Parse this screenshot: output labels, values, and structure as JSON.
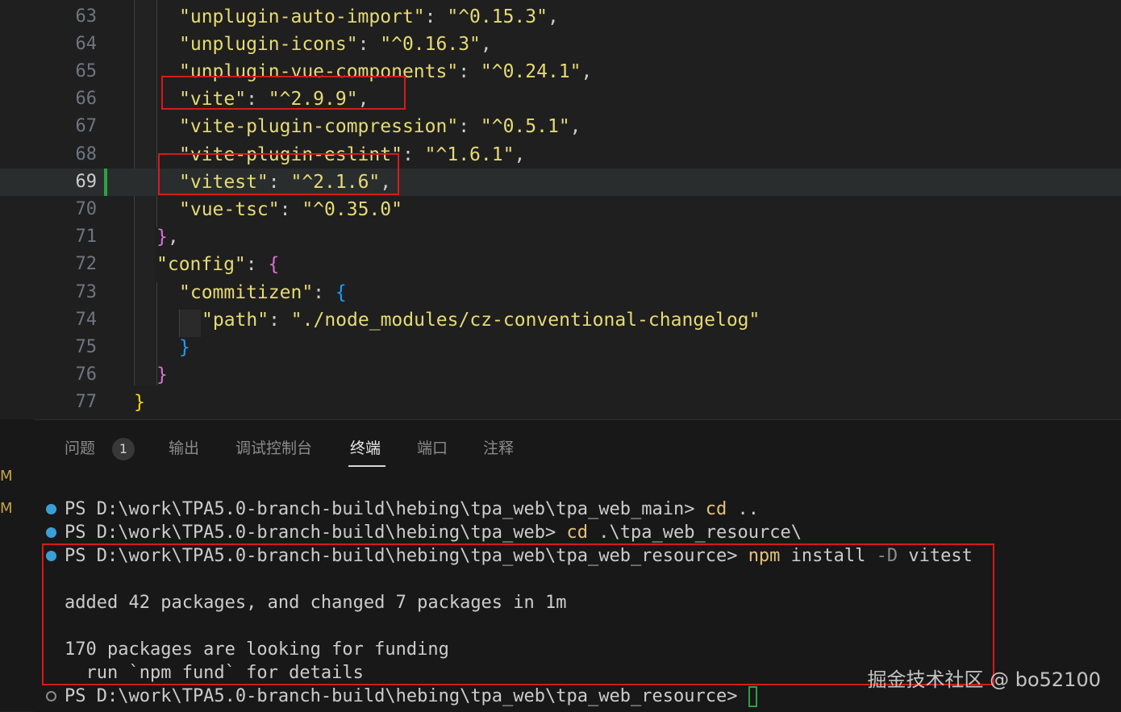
{
  "editor": {
    "lines": [
      {
        "n": "63",
        "key": "\"unplugin-auto-import\"",
        "val": "\"^0.15.3\"",
        "tail": ","
      },
      {
        "n": "64",
        "key": "\"unplugin-icons\"",
        "val": "\"^0.16.3\"",
        "tail": ","
      },
      {
        "n": "65",
        "key": "\"unplugin-vue-components\"",
        "val": "\"^0.24.1\"",
        "tail": ","
      },
      {
        "n": "66",
        "key": "\"vite\"",
        "val": "\"^2.9.9\"",
        "tail": ","
      },
      {
        "n": "67",
        "key": "\"vite-plugin-compression\"",
        "val": "\"^0.5.1\"",
        "tail": ","
      },
      {
        "n": "68",
        "key": "\"vite-plugin-eslint\"",
        "val": "\"^1.6.1\"",
        "tail": ","
      },
      {
        "n": "69",
        "key": "\"vitest\"",
        "val": "\"^2.1.6\"",
        "tail": ","
      },
      {
        "n": "70",
        "key": "\"vue-tsc\"",
        "val": "\"^0.35.0\"",
        "tail": ""
      },
      {
        "n": "71",
        "brace": "}",
        "tail": ","
      },
      {
        "n": "72",
        "key": "\"config\"",
        "brace": "{"
      },
      {
        "n": "73",
        "key": "\"commitizen\"",
        "brace": "{"
      },
      {
        "n": "74",
        "key": "\"path\"",
        "val": "\"./node_modules/cz-conventional-changelog\"",
        "tail": ""
      },
      {
        "n": "75",
        "brace": "}"
      },
      {
        "n": "76",
        "brace": "}"
      },
      {
        "n": "77",
        "brace": "}"
      }
    ]
  },
  "panel": {
    "tabs": [
      {
        "label": "问题"
      },
      {
        "label": "输出"
      },
      {
        "label": "调试控制台"
      },
      {
        "label": "终端"
      },
      {
        "label": "端口"
      },
      {
        "label": "注释"
      }
    ],
    "problems_count": "1",
    "side_markers": [
      "M",
      "M"
    ]
  },
  "terminal": {
    "prompt1": "PS D:\\work\\TPA5.0-branch-build\\hebing\\tpa_web\\tpa_web_main> ",
    "cmd1": "cd",
    "arg1": " ..",
    "prompt2": "PS D:\\work\\TPA5.0-branch-build\\hebing\\tpa_web> ",
    "cmd2": "cd",
    "arg2": " .\\tpa_web_resource\\",
    "prompt3": "PS D:\\work\\TPA5.0-branch-build\\hebing\\tpa_web\\tpa_web_resource> ",
    "cmd3": "npm",
    "arg3a": " install ",
    "flag3": "-D",
    "arg3b": " vitest",
    "out1": "added 42 packages, and changed 7 packages in 1m",
    "out2": "170 packages are looking for funding",
    "out3": "  run `npm fund` for details",
    "prompt4": "PS D:\\work\\TPA5.0-branch-build\\hebing\\tpa_web\\tpa_web_resource> "
  },
  "watermark": "掘金技术社区 @ bo52100"
}
